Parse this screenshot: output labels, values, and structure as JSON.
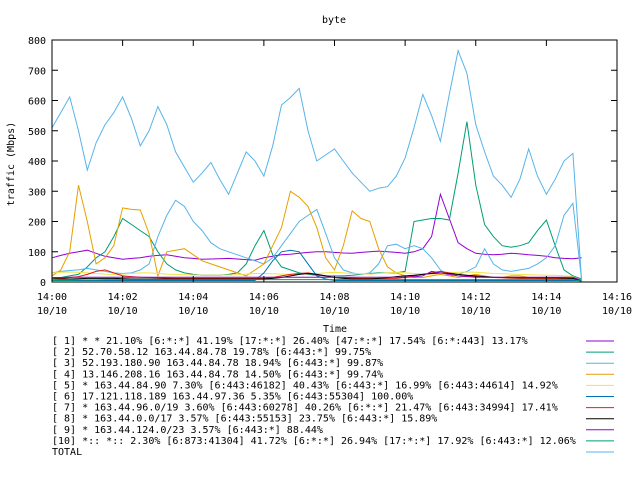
{
  "chart_data": {
    "type": "line",
    "title": "byte",
    "xlabel": "Time",
    "ylabel": "traffic (Mbps)",
    "ylim": [
      0,
      800
    ],
    "yticks": [
      0,
      100,
      200,
      300,
      400,
      500,
      600,
      700,
      800
    ],
    "xlim_minutes": [
      0,
      16
    ],
    "xticks": [
      {
        "m": 0,
        "l1": "14:00",
        "l2": "10/10"
      },
      {
        "m": 2,
        "l1": "14:02",
        "l2": "10/10"
      },
      {
        "m": 4,
        "l1": "14:04",
        "l2": "10/10"
      },
      {
        "m": 6,
        "l1": "14:06",
        "l2": "10/10"
      },
      {
        "m": 8,
        "l1": "14:08",
        "l2": "10/10"
      },
      {
        "m": 10,
        "l1": "14:10",
        "l2": "10/10"
      },
      {
        "m": 12,
        "l1": "14:12",
        "l2": "10/10"
      },
      {
        "m": 14,
        "l1": "14:14",
        "l2": "10/10"
      },
      {
        "m": 16,
        "l1": "14:16",
        "l2": "10/10"
      }
    ],
    "grid": false,
    "legend_position": "bottom",
    "x": [
      0,
      0.25,
      0.5,
      0.75,
      1,
      1.25,
      1.5,
      1.75,
      2,
      2.25,
      2.5,
      2.75,
      3,
      3.25,
      3.5,
      3.75,
      4,
      4.25,
      4.5,
      4.75,
      5,
      5.25,
      5.5,
      5.75,
      6,
      6.25,
      6.5,
      6.75,
      7,
      7.25,
      7.5,
      7.75,
      8,
      8.25,
      8.5,
      8.75,
      9,
      9.25,
      9.5,
      9.75,
      10,
      10.25,
      10.5,
      10.75,
      11,
      11.25,
      11.5,
      11.75,
      12,
      12.25,
      12.5,
      12.75,
      13,
      13.25,
      13.5,
      13.75,
      14,
      14.25,
      14.5,
      14.75,
      15
    ],
    "series": [
      {
        "name": "[ 1] * * 21.10%  [6:*:*] 41.19% [17:*:*] 26.40% [47:*:*] 17.54% [6:*:443] 13.17%",
        "color": "#9400d3",
        "values": [
          80,
          88,
          95,
          100,
          105,
          95,
          85,
          80,
          75,
          78,
          80,
          85,
          88,
          90,
          85,
          80,
          78,
          75,
          76,
          77,
          78,
          76,
          74,
          72,
          80,
          85,
          90,
          92,
          95,
          98,
          100,
          100,
          98,
          96,
          95,
          98,
          100,
          102,
          100,
          98,
          95,
          100,
          110,
          150,
          290,
          210,
          130,
          110,
          95,
          92,
          90,
          92,
          95,
          93,
          90,
          88,
          85,
          80,
          78,
          77,
          80
        ]
      },
      {
        "name": "[ 2] 52.70.58.12 163.44.84.78 19.78%  [6:443:*] 99.75%",
        "color": "#009e73",
        "values": [
          10,
          15,
          20,
          25,
          50,
          80,
          100,
          150,
          210,
          190,
          170,
          150,
          100,
          60,
          40,
          30,
          25,
          22,
          22,
          22,
          25,
          30,
          60,
          120,
          170,
          90,
          50,
          40,
          30,
          25,
          22,
          20,
          20,
          20,
          22,
          25,
          28,
          30,
          30,
          30,
          35,
          200,
          205,
          210,
          210,
          205,
          360,
          530,
          320,
          190,
          150,
          120,
          115,
          120,
          130,
          170,
          205,
          120,
          40,
          20,
          10
        ]
      },
      {
        "name": "[ 3] 52.193.180.90 163.44.84.78 18.94%  [6:443:*] 99.87%",
        "color": "#56b4e9",
        "values": [
          30,
          35,
          38,
          40,
          45,
          40,
          35,
          30,
          28,
          30,
          40,
          60,
          150,
          220,
          270,
          250,
          200,
          170,
          130,
          110,
          100,
          90,
          80,
          70,
          60,
          80,
          120,
          160,
          200,
          220,
          240,
          160,
          80,
          40,
          30,
          25,
          30,
          60,
          120,
          125,
          110,
          120,
          110,
          80,
          40,
          20,
          25,
          35,
          50,
          110,
          60,
          40,
          35,
          40,
          45,
          60,
          80,
          120,
          220,
          260,
          5
        ]
      },
      {
        "name": "[ 4] 13.146.208.16 163.44.84.78 14.50%  [6:443:*] 99.74%",
        "color": "#e69f00",
        "values": [
          20,
          40,
          100,
          320,
          200,
          60,
          80,
          120,
          245,
          240,
          238,
          160,
          20,
          100,
          105,
          110,
          90,
          70,
          60,
          50,
          40,
          30,
          20,
          40,
          60,
          120,
          180,
          300,
          280,
          250,
          180,
          80,
          40,
          120,
          235,
          210,
          200,
          110,
          50,
          30,
          20,
          15,
          15,
          20,
          25,
          20,
          15,
          20,
          25,
          20,
          15,
          15,
          20,
          20,
          15,
          12,
          10,
          10,
          10,
          10,
          5
        ]
      },
      {
        "name": "[ 5] * 163.44.84.90 7.30%  [6:443:46182] 40.43% [6:443:*] 16.99% [6:443:44614] 14.92%",
        "color": "#f0e442",
        "values": [
          30,
          32,
          33,
          32,
          30,
          28,
          26,
          25,
          26,
          28,
          30,
          30,
          28,
          26,
          25,
          24,
          23,
          22,
          22,
          22,
          23,
          24,
          26,
          28,
          28,
          27,
          26,
          25,
          26,
          27,
          28,
          30,
          32,
          30,
          28,
          27,
          26,
          28,
          30,
          32,
          30,
          28,
          27,
          26,
          28,
          30,
          32,
          33,
          32,
          30,
          28,
          27,
          26,
          25,
          24,
          23,
          22,
          22,
          20,
          18,
          5
        ]
      },
      {
        "name": "[ 6] 17.121.118.189 163.44.97.36 5.35%  [6:443:55304] 100.00%",
        "color": "#0072b2",
        "values": [
          5,
          5,
          5,
          5,
          5,
          5,
          5,
          5,
          5,
          5,
          5,
          5,
          5,
          5,
          5,
          5,
          5,
          5,
          5,
          5,
          5,
          5,
          5,
          5,
          30,
          70,
          100,
          105,
          100,
          60,
          20,
          10,
          5,
          5,
          5,
          5,
          5,
          5,
          5,
          5,
          5,
          5,
          5,
          5,
          5,
          5,
          5,
          5,
          5,
          5,
          5,
          5,
          5,
          5,
          5,
          5,
          5,
          5,
          5,
          5,
          5
        ]
      },
      {
        "name": "[ 7] * 163.44.96.0/19 3.60%  [6:443:60278] 40.26% [6:*:*] 21.47% [6:443:34994] 17.41%",
        "color": "#e51e10",
        "values": [
          10,
          12,
          15,
          18,
          25,
          35,
          40,
          30,
          20,
          18,
          16,
          15,
          14,
          13,
          12,
          12,
          12,
          12,
          12,
          12,
          12,
          12,
          12,
          12,
          12,
          15,
          20,
          25,
          28,
          30,
          25,
          20,
          15,
          14,
          13,
          12,
          12,
          12,
          12,
          12,
          15,
          20,
          25,
          30,
          35,
          30,
          25,
          20,
          18,
          16,
          15,
          14,
          13,
          12,
          12,
          12,
          12,
          12,
          12,
          12,
          5
        ]
      },
      {
        "name": "[ 8] * 163.44.0.0/17 3.57%  [6:443:55153] 23.75% [6:443:*] 15.89%",
        "color": "#000000",
        "values": [
          10,
          10,
          10,
          11,
          12,
          12,
          12,
          12,
          11,
          10,
          10,
          10,
          10,
          10,
          10,
          10,
          10,
          10,
          10,
          10,
          10,
          10,
          10,
          10,
          10,
          12,
          15,
          20,
          25,
          28,
          25,
          20,
          15,
          12,
          10,
          10,
          10,
          12,
          14,
          18,
          20,
          22,
          25,
          28,
          30,
          28,
          25,
          22,
          20,
          18,
          16,
          15,
          14,
          14,
          14,
          14,
          14,
          14,
          13,
          12,
          5
        ]
      },
      {
        "name": "[ 9] * 163.44.124.0/23 3.57%  [6:443:*] 88.44%",
        "color": "#9400d3",
        "values": [
          15,
          15,
          16,
          16,
          16,
          16,
          16,
          16,
          16,
          16,
          16,
          16,
          16,
          16,
          16,
          16,
          16,
          16,
          16,
          16,
          16,
          16,
          16,
          16,
          16,
          16,
          16,
          16,
          16,
          16,
          16,
          16,
          16,
          16,
          16,
          16,
          16,
          16,
          16,
          16,
          16,
          17,
          20,
          35,
          30,
          25,
          20,
          18,
          16,
          16,
          16,
          16,
          16,
          16,
          16,
          16,
          16,
          16,
          16,
          16,
          5
        ]
      },
      {
        "name": "[10] *:: *:: 2.30%  [6:873:41304] 41.72% [6:*:*] 26.94% [17:*:*] 17.92% [6:443:*] 12.06%",
        "color": "#009e73",
        "values": [
          5,
          6,
          6,
          7,
          7,
          7,
          8,
          8,
          8,
          8,
          8,
          8,
          8,
          8,
          8,
          8,
          8,
          8,
          8,
          8,
          8,
          8,
          8,
          8,
          8,
          8,
          8,
          8,
          8,
          8,
          8,
          8,
          8,
          8,
          8,
          8,
          8,
          8,
          8,
          8,
          8,
          8,
          8,
          8,
          8,
          8,
          8,
          8,
          8,
          8,
          8,
          8,
          8,
          8,
          8,
          8,
          8,
          8,
          8,
          8,
          3
        ]
      },
      {
        "name": "TOTAL",
        "color": "#56b4e9",
        "values": [
          510,
          560,
          612,
          500,
          370,
          460,
          520,
          560,
          612,
          540,
          450,
          500,
          580,
          520,
          430,
          380,
          330,
          360,
          395,
          340,
          290,
          360,
          430,
          400,
          350,
          450,
          585,
          610,
          640,
          500,
          400,
          420,
          440,
          400,
          360,
          330,
          300,
          310,
          315,
          350,
          410,
          510,
          620,
          550,
          465,
          620,
          765,
          690,
          520,
          430,
          350,
          320,
          280,
          340,
          440,
          350,
          290,
          340,
          400,
          425,
          0
        ]
      }
    ]
  }
}
